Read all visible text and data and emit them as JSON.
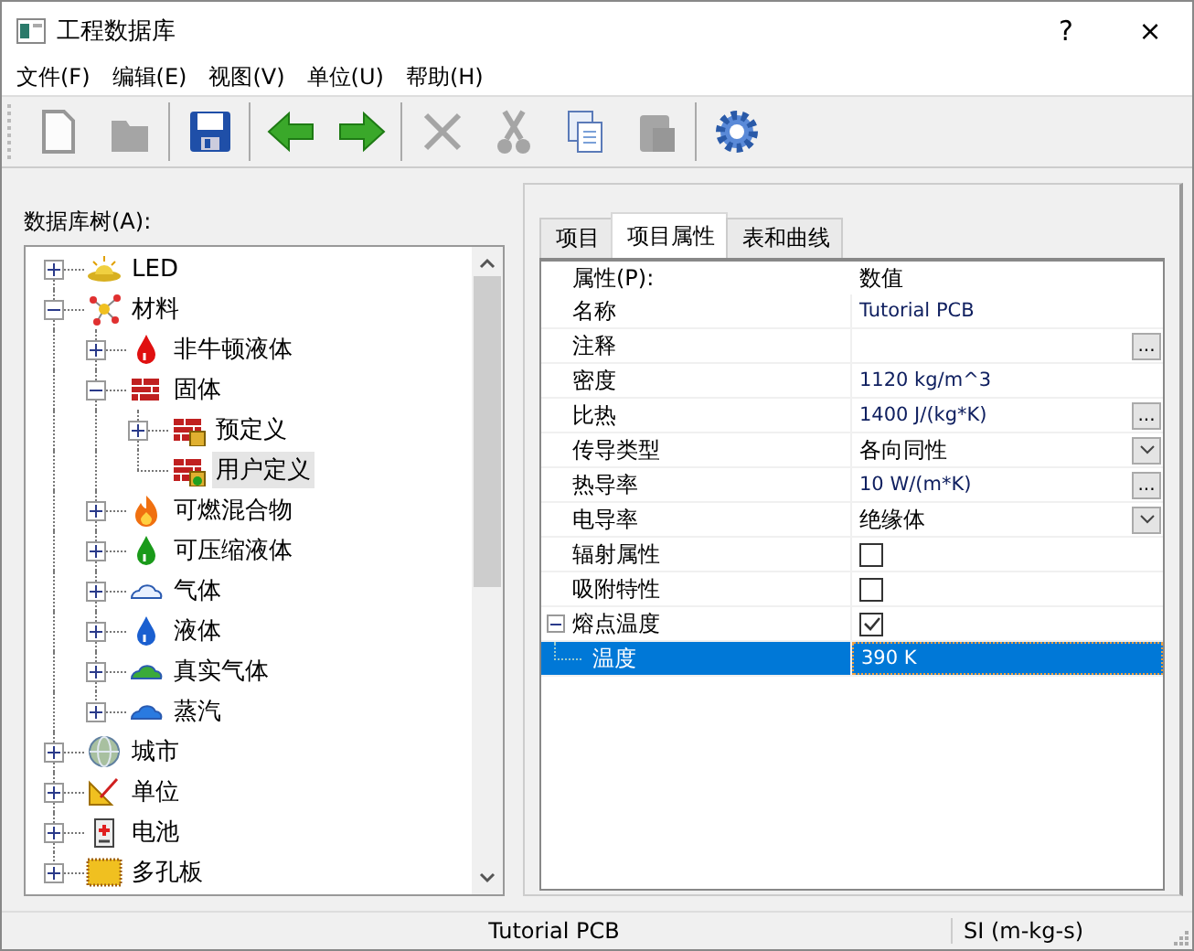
{
  "window": {
    "title": "工程数据库",
    "help": "?",
    "close": "×"
  },
  "menu": [
    "文件(F)",
    "编辑(E)",
    "视图(V)",
    "单位(U)",
    "帮助(H)"
  ],
  "toolbar": [
    [
      {
        "kind": "new",
        "disabled": true
      },
      {
        "kind": "open",
        "disabled": true
      }
    ],
    [
      {
        "kind": "save",
        "disabled": false
      }
    ],
    [
      {
        "kind": "back",
        "disabled": false
      },
      {
        "kind": "forward",
        "disabled": false
      }
    ],
    [
      {
        "kind": "delete",
        "disabled": true
      },
      {
        "kind": "cut",
        "disabled": true
      },
      {
        "kind": "copy",
        "disabled": false
      },
      {
        "kind": "paste",
        "disabled": true
      }
    ],
    [
      {
        "kind": "settings",
        "disabled": false
      }
    ]
  ],
  "tree": {
    "label": "数据库树(A):",
    "items": [
      {
        "label": "LED",
        "kind": "led",
        "expanded": false,
        "selected": false
      },
      {
        "label": "材料",
        "kind": "material",
        "expanded": true,
        "selected": false,
        "children": [
          {
            "label": "非牛顿液体",
            "kind": "red-drop",
            "expanded": false,
            "selected": false
          },
          {
            "label": "固体",
            "kind": "brick",
            "expanded": true,
            "selected": false,
            "children": [
              {
                "label": "预定义",
                "kind": "brick-lock",
                "expanded": false,
                "selected": false
              },
              {
                "label": "用户定义",
                "kind": "brick-user",
                "leaf": true,
                "selected": true
              }
            ]
          },
          {
            "label": "可燃混合物",
            "kind": "flame",
            "expanded": false,
            "selected": false
          },
          {
            "label": "可压缩液体",
            "kind": "green-drop",
            "expanded": false,
            "selected": false
          },
          {
            "label": "气体",
            "kind": "white-cloud",
            "expanded": false,
            "selected": false
          },
          {
            "label": "液体",
            "kind": "blue-drop",
            "expanded": false,
            "selected": false
          },
          {
            "label": "真实气体",
            "kind": "green-cloud",
            "expanded": false,
            "selected": false
          },
          {
            "label": "蒸汽",
            "kind": "blue-cloud",
            "expanded": false,
            "selected": false
          }
        ]
      },
      {
        "label": "城市",
        "kind": "globe",
        "expanded": false,
        "selected": false
      },
      {
        "label": "单位",
        "kind": "ruler",
        "expanded": false,
        "selected": false
      },
      {
        "label": "电池",
        "kind": "battery",
        "expanded": false,
        "selected": false
      },
      {
        "label": "多孔板",
        "kind": "plate",
        "expanded": false,
        "selected": false
      }
    ]
  },
  "tabs": [
    {
      "label": "项目",
      "selected": false
    },
    {
      "label": "项目属性",
      "selected": true
    },
    {
      "label": "表和曲线",
      "selected": false
    }
  ],
  "properties": {
    "columns": [
      "属性(P):",
      "数值"
    ],
    "rows": [
      {
        "name": "名称",
        "value": "Tutorial PCB",
        "kind": "text",
        "selected": false
      },
      {
        "name": "注释",
        "kind": "button",
        "button": "...",
        "selected": false
      },
      {
        "name": "密度",
        "value": "1120 kg/m^3",
        "kind": "text",
        "selected": false
      },
      {
        "name": "比热",
        "value": "1400 J/(kg*K)",
        "kind": "button",
        "button": "...",
        "selected": false
      },
      {
        "name": "传导类型",
        "value": "各向同性",
        "kind": "dropdown",
        "selected": false
      },
      {
        "name": "热导率",
        "value": "10 W/(m*K)",
        "kind": "button",
        "button": "...",
        "selected": false
      },
      {
        "name": "电导率",
        "value": "绝缘体",
        "kind": "dropdown",
        "selected": false
      },
      {
        "name": "辐射属性",
        "kind": "checkbox",
        "checked": false,
        "selected": false
      },
      {
        "name": "吸附特性",
        "kind": "checkbox",
        "checked": false,
        "selected": false
      },
      {
        "name": "熔点温度",
        "kind": "group",
        "checked": true,
        "expanded": true,
        "selected": false
      },
      {
        "name": "温度",
        "value": "390 K",
        "kind": "child",
        "selected": true
      }
    ]
  },
  "status_bar": [
    "Tutorial PCB",
    "SI (m-kg-s)"
  ]
}
